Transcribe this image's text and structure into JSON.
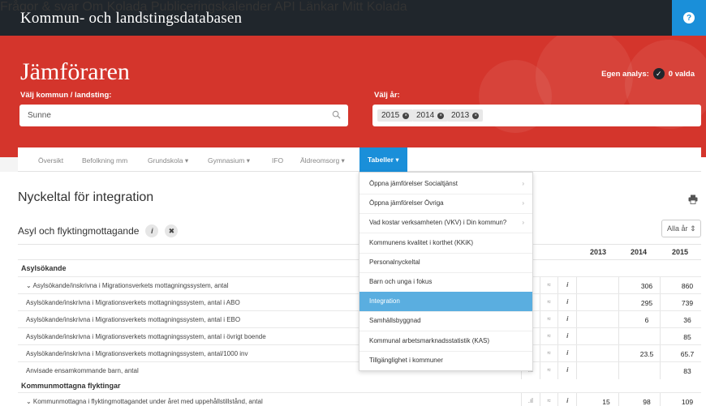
{
  "header": {
    "brand": "Kommun- och landstingsdatabasen",
    "nav": [
      {
        "label": "Frågor & svar"
      },
      {
        "label": "Om Kolada"
      },
      {
        "label": "Publiceringskalender"
      },
      {
        "label": "API"
      },
      {
        "label": "Länkar"
      },
      {
        "label": "Mitt Kolada"
      }
    ],
    "help_label": "?",
    "help_icon": "help-icon"
  },
  "hero": {
    "title": "Jämföraren",
    "egen_analys_label": "Egen analys:",
    "valda_label": "0 valda",
    "kommun_label": "Välj kommun / landsting:",
    "kommun_value": "Sunne",
    "year_label": "Välj år:",
    "years": [
      "2015",
      "2014",
      "2013"
    ],
    "remove_glyph": "×",
    "check_glyph": "✓"
  },
  "subnav": {
    "items": [
      "Översikt",
      "Befolkning mm",
      "Grundskola ▾",
      "Gymnasium ▾",
      "IFO",
      "Äldreomsorg ▾"
    ],
    "active": "Tabeller ▾"
  },
  "content": {
    "title": "Nyckeltal för integration",
    "section_title": "Asyl och flyktingmottagande",
    "info_glyph": "i",
    "close_glyph": "✖",
    "year_select": "Alla år ⇕",
    "columns": [
      "2013",
      "2014",
      "2015"
    ],
    "groups": [
      {
        "name": "Asylsökande",
        "rows": [
          {
            "label": "⌄ Asylsökande/inskrivna i Migrationsverkets mottagningssystem, antal",
            "v2013": "",
            "v2014": "306",
            "v2015": "860"
          },
          {
            "label": "Asylsökande/inskrivna i Migrationsverkets mottagningssystem, antal i ABO",
            "v2013": "",
            "v2014": "295",
            "v2015": "739"
          },
          {
            "label": "Asylsökande/inskrivna i Migrationsverkets mottagningssystem, antal i EBO",
            "v2013": "",
            "v2014": "6",
            "v2015": "36"
          },
          {
            "label": "Asylsökande/inskrivna i Migrationsverkets mottagningssystem, antal i övrigt boende",
            "v2013": "",
            "v2014": "",
            "v2015": "85"
          },
          {
            "label": "Asylsökande/inskrivna i Migrationsverkets mottagningssystem, antal/1000 inv",
            "v2013": "",
            "v2014": "23.5",
            "v2015": "65.7"
          },
          {
            "label": "Anvisade ensamkommande barn, antal",
            "v2013": "",
            "v2014": "",
            "v2015": "83"
          }
        ]
      },
      {
        "name": "Kommunmottagna flyktingar",
        "rows": [
          {
            "label": "⌄ Kommunmottagna i flyktingmottagandet under året med uppehållstillstånd, antal",
            "v2013": "15",
            "v2014": "98",
            "v2015": "109"
          }
        ]
      }
    ],
    "row_icons": {
      "chart": ".ıl",
      "trend": "≈",
      "info": "i"
    }
  },
  "dropdown": {
    "items": [
      {
        "label": "Öppna jämförelser Socialtjänst",
        "arrow": "›"
      },
      {
        "label": "Öppna jämförelser Övriga",
        "arrow": "›"
      },
      {
        "label": "Vad kostar verksamheten (VKV) i Din kommun?",
        "arrow": "›"
      },
      {
        "label": "Kommunens kvalitet i korthet (KKiK)",
        "arrow": ""
      },
      {
        "label": "Personalnyckeltal",
        "arrow": ""
      },
      {
        "label": "Barn och unga i fokus",
        "arrow": ""
      },
      {
        "label": "Integration",
        "arrow": "",
        "active": true
      },
      {
        "label": "Samhällsbyggnad",
        "arrow": ""
      },
      {
        "label": "Kommunal arbetsmarknadsstatistik (KAS)",
        "arrow": ""
      },
      {
        "label": "Tillgänglighet i kommuner",
        "arrow": ""
      }
    ]
  },
  "colors": {
    "topbar": "#20262c",
    "hero": "#d4352c",
    "accent": "#1a8fd9",
    "dropdown_active": "#5aaee0"
  }
}
